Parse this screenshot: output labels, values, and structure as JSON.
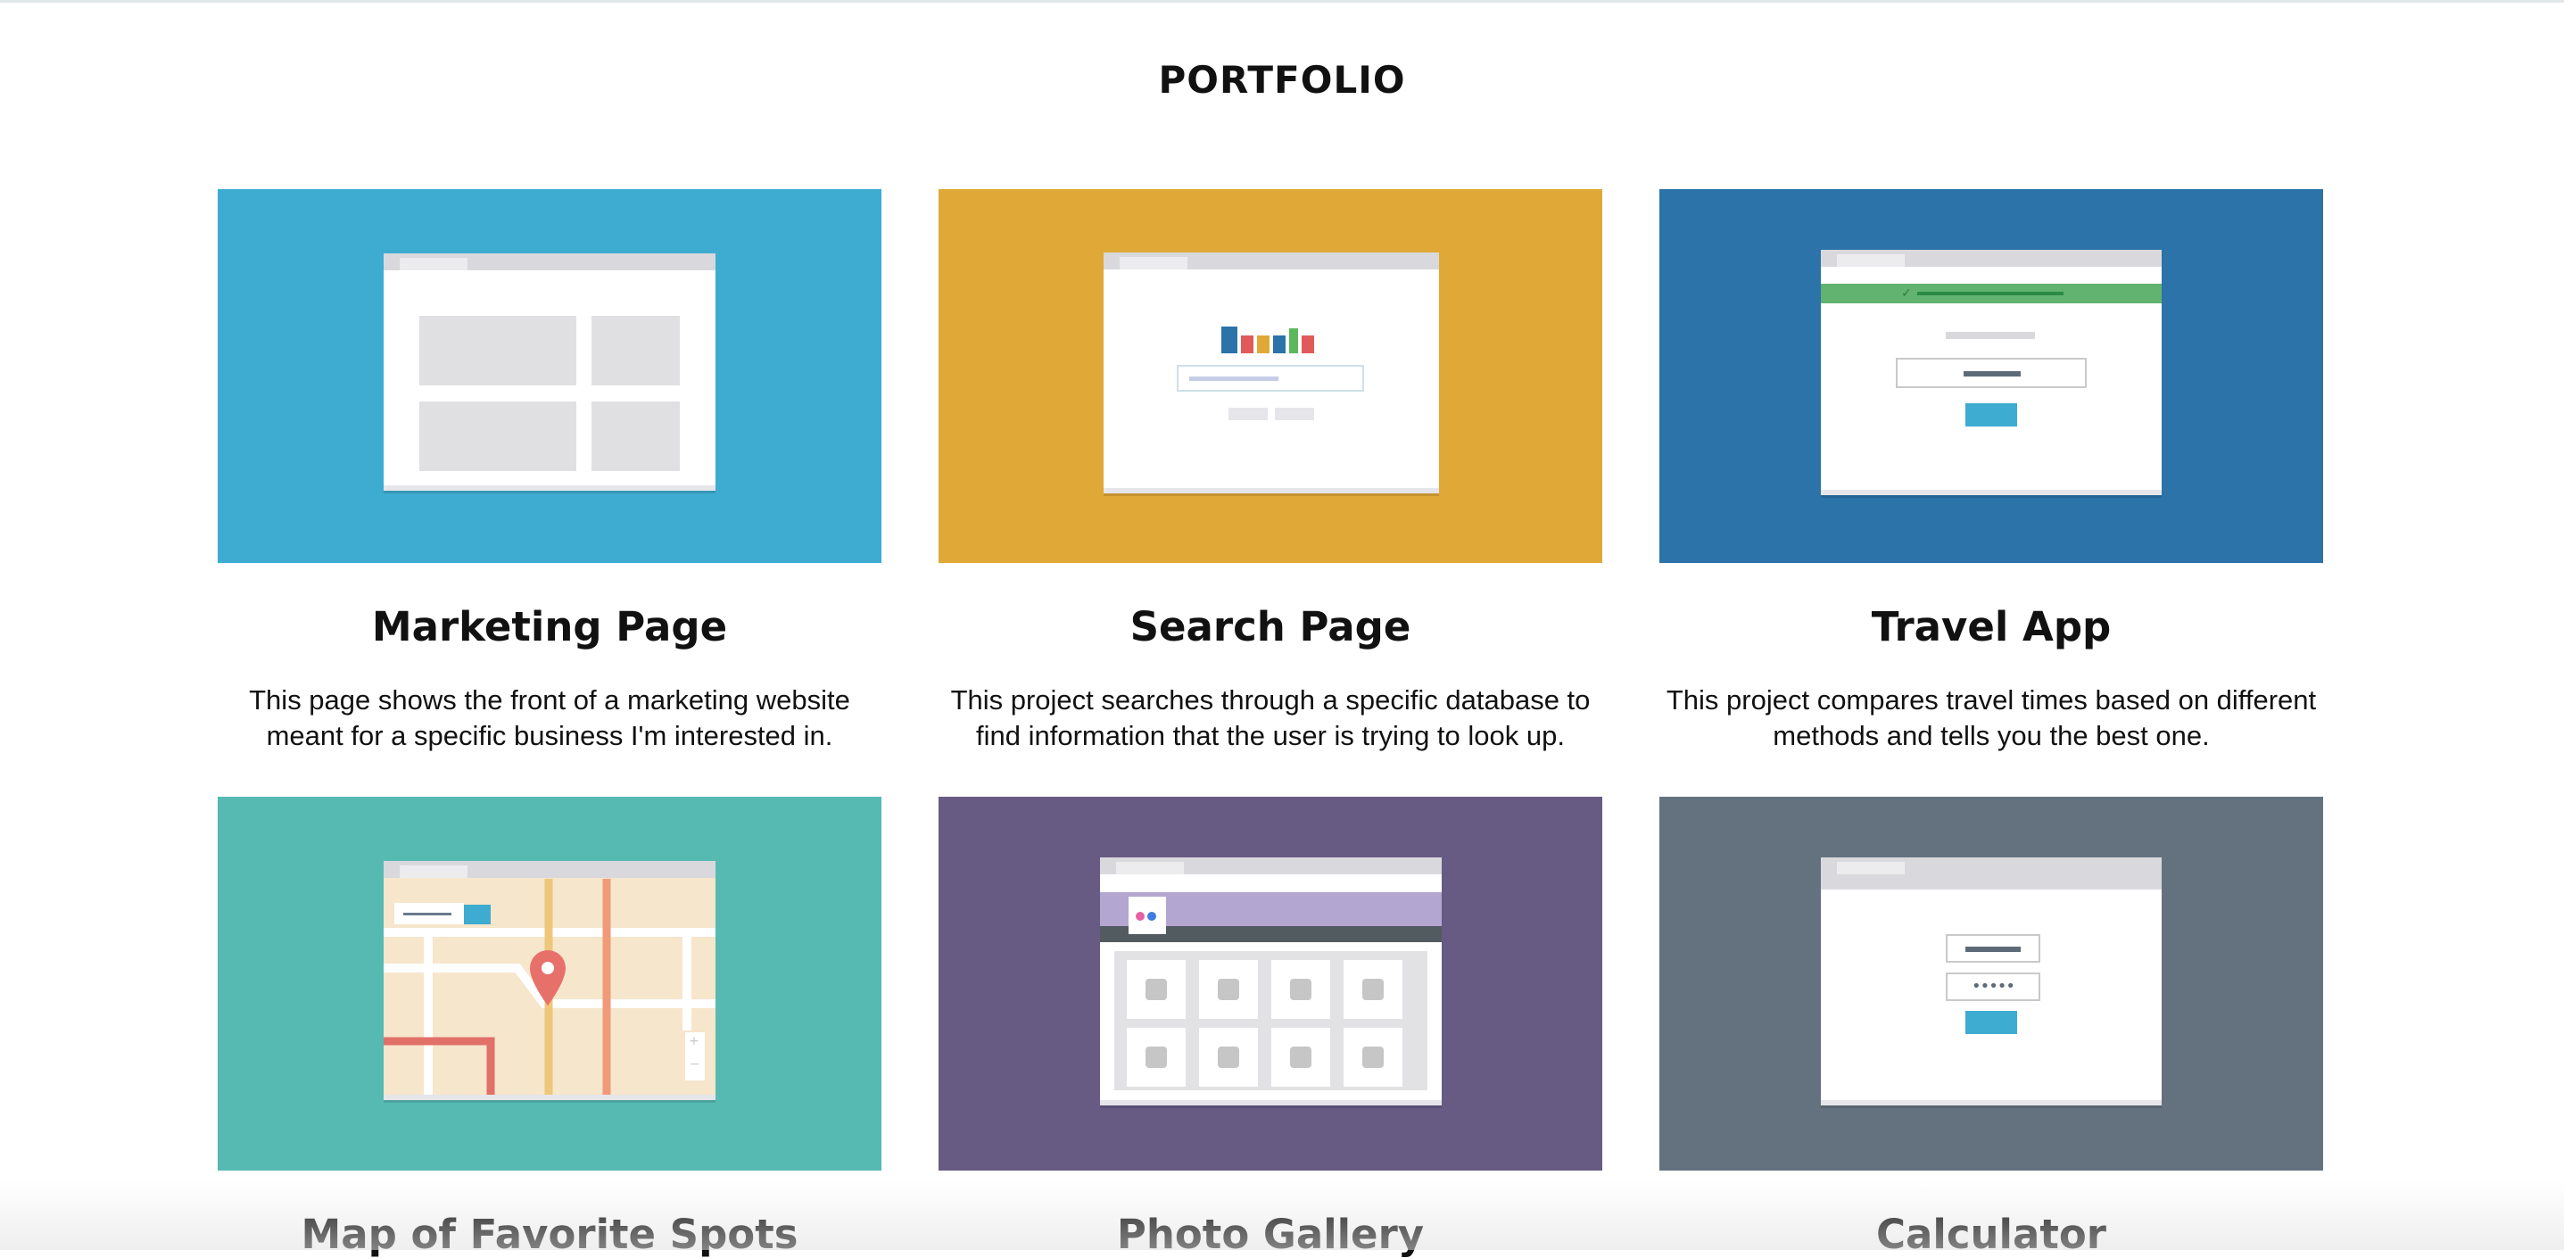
{
  "page": {
    "title": "PORTFOLIO"
  },
  "projects": [
    {
      "title": "Marketing Page",
      "description": "This page shows the front of a marketing website meant for a specific business I'm interested in.",
      "color": "#3eabd0"
    },
    {
      "title": "Search Page",
      "description": "This project searches through a specific database to find information that the user is trying to look up.",
      "color": "#e0a937"
    },
    {
      "title": "Travel App",
      "description": "This project compares travel times based on different methods and tells you the best one.",
      "color": "#2b73a8"
    },
    {
      "title": "Map of Favorite Spots",
      "description": "",
      "color": "#56bab2"
    },
    {
      "title": "Photo Gallery",
      "description": "",
      "color": "#675b84"
    },
    {
      "title": "Calculator",
      "description": "",
      "color": "#64727f"
    }
  ],
  "calculator_mock": {
    "password_dots": "•••••"
  }
}
